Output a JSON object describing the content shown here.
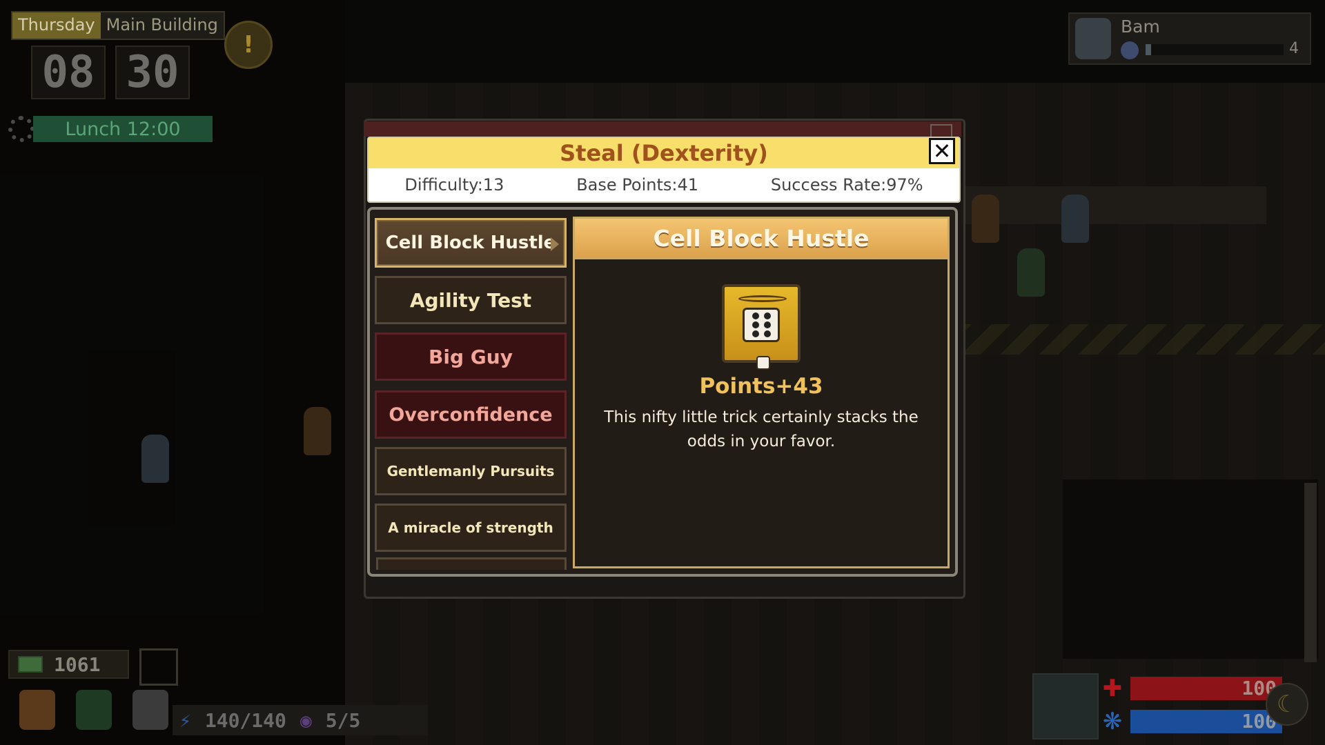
{
  "hud": {
    "day": "Thursday",
    "location": "Main Building",
    "clock_hour": "08",
    "clock_minute": "30",
    "schedule": "Lunch 12:00",
    "player_name": "Bam",
    "player_count": "4",
    "money": "1061",
    "energy": "140/140",
    "vision": "5/5",
    "health": "100",
    "mind": "100",
    "colors": {
      "health": "#b3161d",
      "mind": "#1c5fc7"
    }
  },
  "modal": {
    "title": "Steal (Dexterity)",
    "difficulty": "Difficulty:13",
    "base_points": "Base Points:41",
    "success_rate": "Success Rate:97%",
    "close_icon": "✕"
  },
  "cards": [
    {
      "label": "Cell Block Hustle",
      "variant": "selected"
    },
    {
      "label": "Agility Test",
      "variant": "normal"
    },
    {
      "label": "Big Guy",
      "variant": "red"
    },
    {
      "label": "Overconfidence",
      "variant": "red"
    },
    {
      "label": "Gentlemanly Pursuits",
      "variant": "normal"
    },
    {
      "label": "A miracle of strength",
      "variant": "normal"
    }
  ],
  "detail": {
    "title": "Cell Block Hustle",
    "icon": "dice-icon",
    "points": "Points+43",
    "description": "This nifty little trick certainly stacks the odds in your favor."
  }
}
